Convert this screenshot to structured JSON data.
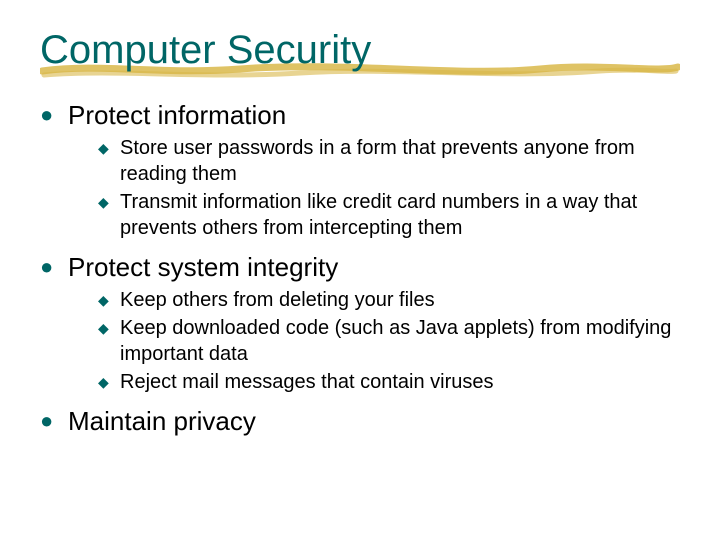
{
  "title": "Computer Security",
  "bullets": [
    {
      "text": "Protect information",
      "sub": [
        "Store user passwords in a form that prevents anyone from reading them",
        "Transmit information like credit card numbers in a way that prevents others from intercepting them"
      ]
    },
    {
      "text": "Protect system integrity",
      "sub": [
        "Keep others from deleting your files",
        "Keep downloaded code (such as Java applets) from modifying important data",
        "Reject mail messages that contain viruses"
      ]
    },
    {
      "text": "Maintain privacy",
      "sub": []
    }
  ]
}
